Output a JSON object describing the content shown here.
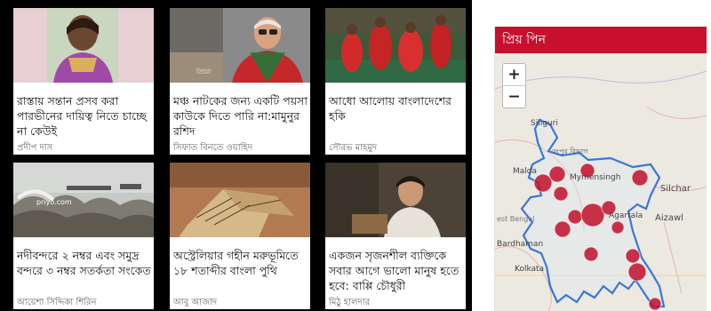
{
  "cards": [
    {
      "title": "রাস্তায় সন্তান প্রসব করা পারভীনের দায়িত্ব নিতে চাচ্ছে না কেউই",
      "author": "প্রদীপ দাস"
    },
    {
      "title": "মঞ্চ নাটকের জন্য একটি পয়সা কাউকে দিতে পারি না:মামুনুর রশিদ",
      "author": "সিফাত বিনতে ওয়াহিদ",
      "watermark": "প্রিয়ো"
    },
    {
      "title": "আধো আলোয় বাংলাদেশের হকি",
      "author": "সৌরভ মাহমুদ"
    },
    {
      "title": "নদীবন্দরে ২ নম্বর এবং সমুদ্র বন্দরে ৩ নম্বর সতর্কতা সংকেত",
      "author": "আয়েশা সিদ্দিকা শিরিন",
      "watermark": "priyo.com"
    },
    {
      "title": "অস্ট্রেলিয়ার গহীন মরুভূমিতে ১৮ শতাব্দীর বাংলা পুথি",
      "author": "আবু আজাদ"
    },
    {
      "title": "একজন সৃজনশীল ব্যক্তিকে সবার আগে ভালো মানুষ হতে হবে: বাপ্পি চৌধুরী",
      "author": "মিঠু হালদার"
    }
  ],
  "map": {
    "header": "প্রিয় পিন",
    "zoom_in": "+",
    "zoom_out": "−",
    "labels": {
      "siliguri": "Siliguri",
      "rangpur": "রংপুর বিভাগ",
      "malda": "Malda",
      "mymensingh": "Mymensingh",
      "silchar": "Silchar",
      "agartala": "Agartala",
      "aizawl": "Aizawl",
      "bengal": "est Bengal",
      "bardhaman": "Bardhaman",
      "kolkata": "Kolkata"
    }
  }
}
